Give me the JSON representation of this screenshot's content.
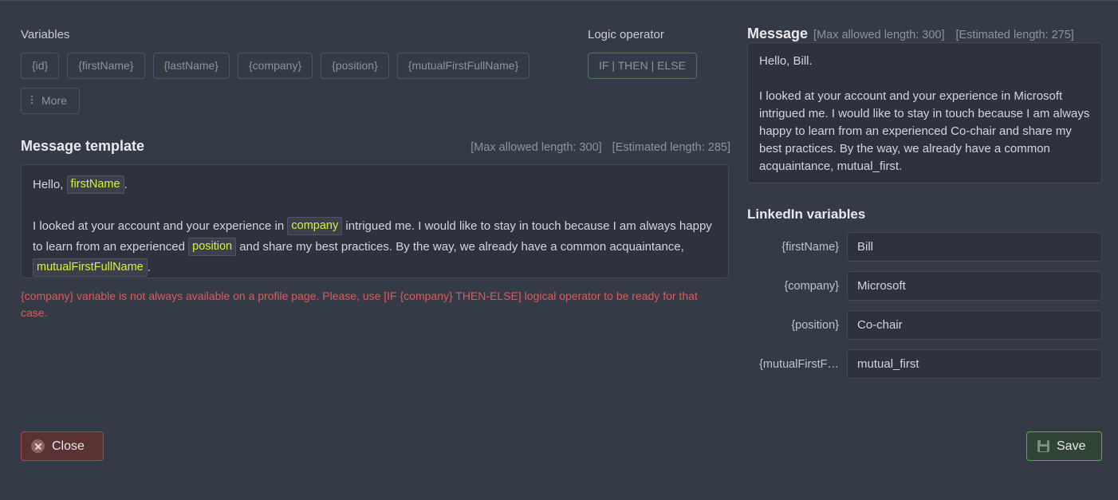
{
  "colors": {
    "page_bg": "#343a46",
    "panel_bg": "#2e323c",
    "chip_border": "#4b5570",
    "logic_border": "#4a7a52",
    "token_text": "#d7f23c",
    "warning_text": "#e05a5a",
    "close_border": "#a04c4c",
    "save_border": "#4caf50"
  },
  "left": {
    "variables_label": "Variables",
    "chips": [
      {
        "label": "{id}",
        "name": "variable-chip-id"
      },
      {
        "label": "{firstName}",
        "name": "variable-chip-firstname"
      },
      {
        "label": "{lastName}",
        "name": "variable-chip-lastname"
      },
      {
        "label": "{company}",
        "name": "variable-chip-company"
      },
      {
        "label": "{position}",
        "name": "variable-chip-position"
      },
      {
        "label": "{mutualFirstFullName}",
        "name": "variable-chip-mutualfirstfullname"
      }
    ],
    "more_label": "More",
    "logic": {
      "label": "Logic operator",
      "button_label": "IF | THEN | ELSE"
    },
    "template": {
      "title": "Message template",
      "max_length_label": "[Max allowed length: 300]",
      "estimated_length_label": "[Estimated length: 285]",
      "line1_before": "Hello,",
      "line1_token": "firstName",
      "line1_after": ".",
      "line2_part1": "I looked at your account and your experience in",
      "line2_token1": "company",
      "line2_part2": "intrigued me. I would like to stay in touch because I am always happy to learn from an experienced",
      "line2_token2": "position",
      "line2_part3": "and share my best practices. By the way, we already have a common acquaintance,",
      "line2_token3": "mutualFirstFullName",
      "line2_part4": "."
    },
    "warning": "{company} variable is not always available on a profile page. Please, use [IF {company} THEN-ELSE] logical operator to be ready for that case."
  },
  "right": {
    "message": {
      "title": "Message",
      "max_length_label": "[Max allowed length: 300]",
      "estimated_length_label": "[Estimated length: 275]",
      "line1": "Hello, Bill.",
      "line2": "I looked at your account and your experience in Microsoft intrigued me. I would like to stay in touch because I am always happy to learn from an experienced Co-chair and share my best practices. By the way, we already have a common acquaintance, mutual_first."
    },
    "linkedin_variables": {
      "title": "LinkedIn variables",
      "rows": [
        {
          "label": "{firstName}",
          "value": "Bill",
          "name": "linkedin-var-firstname"
        },
        {
          "label": "{company}",
          "value": "Microsoft",
          "name": "linkedin-var-company"
        },
        {
          "label": "{position}",
          "value": "Co-chair",
          "name": "linkedin-var-position"
        },
        {
          "label": "{mutualFirstF…",
          "value": "mutual_first",
          "name": "linkedin-var-mutualfirstfullname"
        }
      ]
    }
  },
  "footer": {
    "close_label": "Close",
    "save_label": "Save"
  }
}
